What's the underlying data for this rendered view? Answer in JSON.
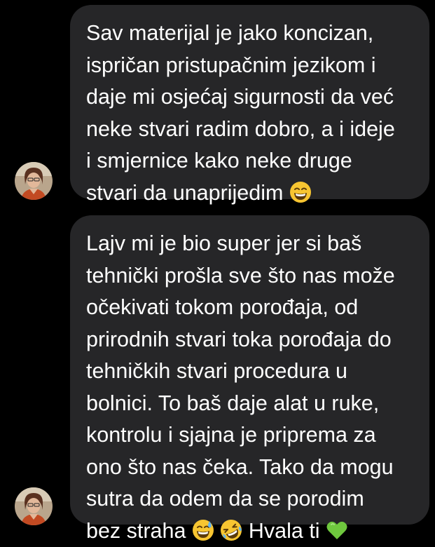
{
  "chat": {
    "messages": [
      {
        "lines": [
          "Sav materijal je jako koncizan,",
          "ispričan pristupačnim jezikom i",
          "daje mi osjećaj sigurnosti da već",
          "neke stvari radim dobro, a i ideje",
          "i smjernice kako neke druge",
          "stvari da unaprijedim"
        ],
        "trailing_emoji": "grinning-face-with-smiling-eyes"
      },
      {
        "lines": [
          "Lajv mi je bio super jer si baš",
          "tehnički prošla sve što nas može",
          "očekivati tokom porođaja, od",
          "prirodnih stvari toka porođaja do",
          "tehničkih stvari procedura u",
          "bolnici. To baš daje alat u ruke,",
          "kontrolu i sjajna je priprema za",
          "ono što nas čeka. Tako da mogu",
          "sutra da odem da se porodim",
          "bez straha"
        ],
        "last_line_suffix": "Hvala ti",
        "trailing_emojis": [
          "grinning-face-with-sweat",
          "rolling-on-the-floor-laughing",
          "green-heart"
        ]
      }
    ]
  },
  "colors": {
    "background": "#000000",
    "bubble": "#262628",
    "text": "#ffffff",
    "emoji_yellow": "#f7c531",
    "heart_green": "#6fc83e"
  }
}
